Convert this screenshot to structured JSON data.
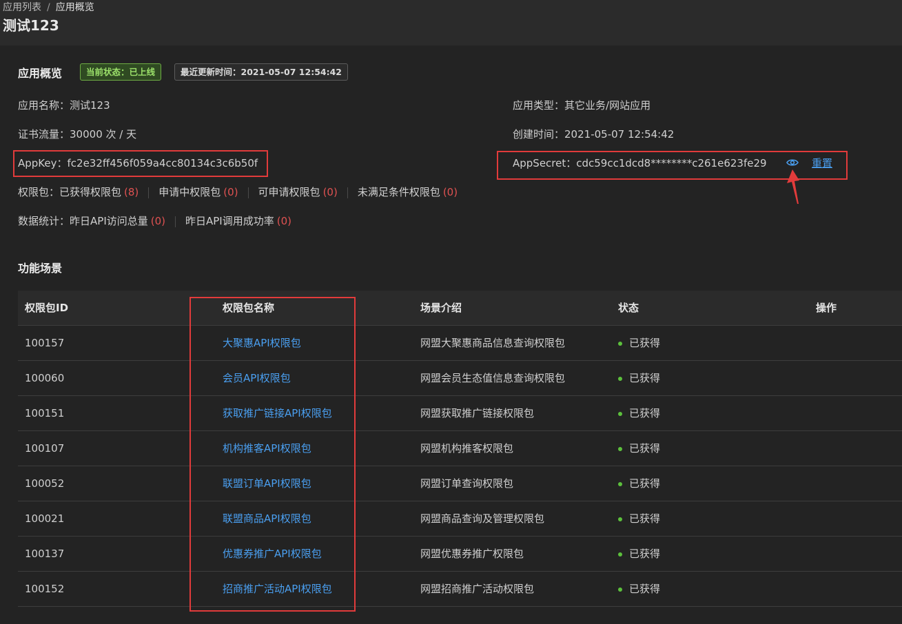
{
  "breadcrumb": {
    "parent": "应用列表",
    "separator": "/",
    "current": "应用概览"
  },
  "page_title": "测试123",
  "overview": {
    "title": "应用概览",
    "status_tag": "当前状态：已上线",
    "updated_tag": "最近更新时间：2021-05-07 12:54:42",
    "app_name_label": "应用名称：",
    "app_name": "测试123",
    "app_type_label": "应用类型：",
    "app_type": "其它业务/网站应用",
    "quota_label": "证书流量：",
    "quota": "30000 次 / 天",
    "created_label": "创建时间：",
    "created": "2021-05-07 12:54:42",
    "appkey_label": "AppKey：",
    "appkey": "fc2e32ff456f059a4cc80134c3c6b50f",
    "appsecret_label": "AppSecret：",
    "appsecret": "cdc59cc1dcd8********c261e623fe29",
    "reset_label": "重置",
    "eye_icon": "eye-icon",
    "permissions_label": "权限包：",
    "permissions": [
      {
        "label": "已获得权限包",
        "count": "(8)"
      },
      {
        "label": "申请中权限包",
        "count": "(0)"
      },
      {
        "label": "可申请权限包",
        "count": "(0)"
      },
      {
        "label": "未满足条件权限包",
        "count": "(0)"
      }
    ],
    "stats_label": "数据统计：",
    "stats": [
      {
        "label": "昨日API访问总量",
        "count": "(0)"
      },
      {
        "label": "昨日API调用成功率",
        "count": "(0)"
      }
    ]
  },
  "scenes": {
    "title": "功能场景",
    "columns": [
      "权限包ID",
      "权限包名称",
      "场景介绍",
      "状态",
      "操作"
    ],
    "rows": [
      {
        "id": "100157",
        "name": "大聚惠API权限包",
        "desc": "网盟大聚惠商品信息查询权限包",
        "state": "已获得"
      },
      {
        "id": "100060",
        "name": "会员API权限包",
        "desc": "网盟会员生态值信息查询权限包",
        "state": "已获得"
      },
      {
        "id": "100151",
        "name": "获取推广链接API权限包",
        "desc": "网盟获取推广链接权限包",
        "state": "已获得"
      },
      {
        "id": "100107",
        "name": "机构推客API权限包",
        "desc": "网盟机构推客权限包",
        "state": "已获得"
      },
      {
        "id": "100052",
        "name": "联盟订单API权限包",
        "desc": "网盟订单查询权限包",
        "state": "已获得"
      },
      {
        "id": "100021",
        "name": "联盟商品API权限包",
        "desc": "网盟商品查询及管理权限包",
        "state": "已获得"
      },
      {
        "id": "100137",
        "name": "优惠券推广API权限包",
        "desc": "网盟优惠券推广权限包",
        "state": "已获得"
      },
      {
        "id": "100152",
        "name": "招商推广活动API权限包",
        "desc": "网盟招商推广活动权限包",
        "state": "已获得"
      }
    ]
  },
  "colors": {
    "link": "#4a9ff0",
    "highlight_box": "#e23b3b",
    "status_dot": "#5cc03c",
    "count": "#e05252"
  }
}
